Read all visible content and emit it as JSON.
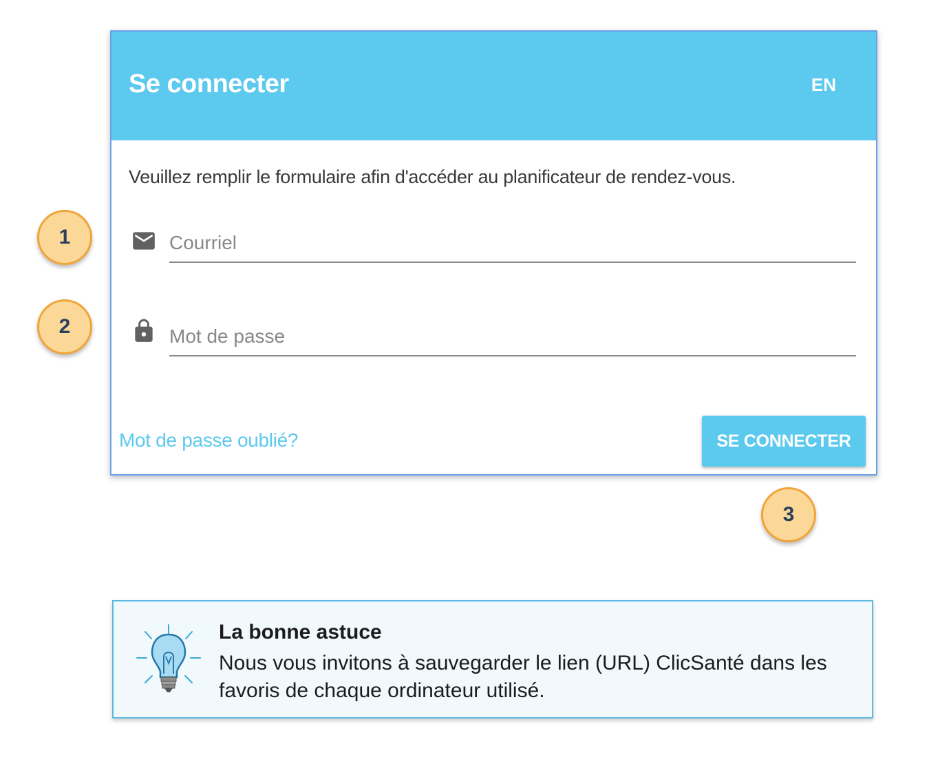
{
  "login": {
    "title": "Se connecter",
    "lang_toggle": "EN",
    "intro": "Veuillez remplir le formulaire afin d'accéder au planificateur de rendez-vous.",
    "email": {
      "placeholder": "Courriel",
      "icon": "mail-icon"
    },
    "password": {
      "placeholder": "Mot de passe",
      "icon": "lock-icon"
    },
    "forgot_password": "Mot de passe oublié?",
    "submit": "SE CONNECTER"
  },
  "markers": [
    "1",
    "2",
    "3"
  ],
  "tip": {
    "icon": "lightbulb-icon",
    "title": "La bonne astuce",
    "body": "Nous vous invitons à sauvegarder le lien (URL) ClicSanté dans les favoris de chaque ordinateur utilisé."
  },
  "colors": {
    "header": "#5cc9ee",
    "marker_fill": "#fbd898",
    "marker_border": "#f0a437",
    "tip_border": "#5cb8e0"
  }
}
